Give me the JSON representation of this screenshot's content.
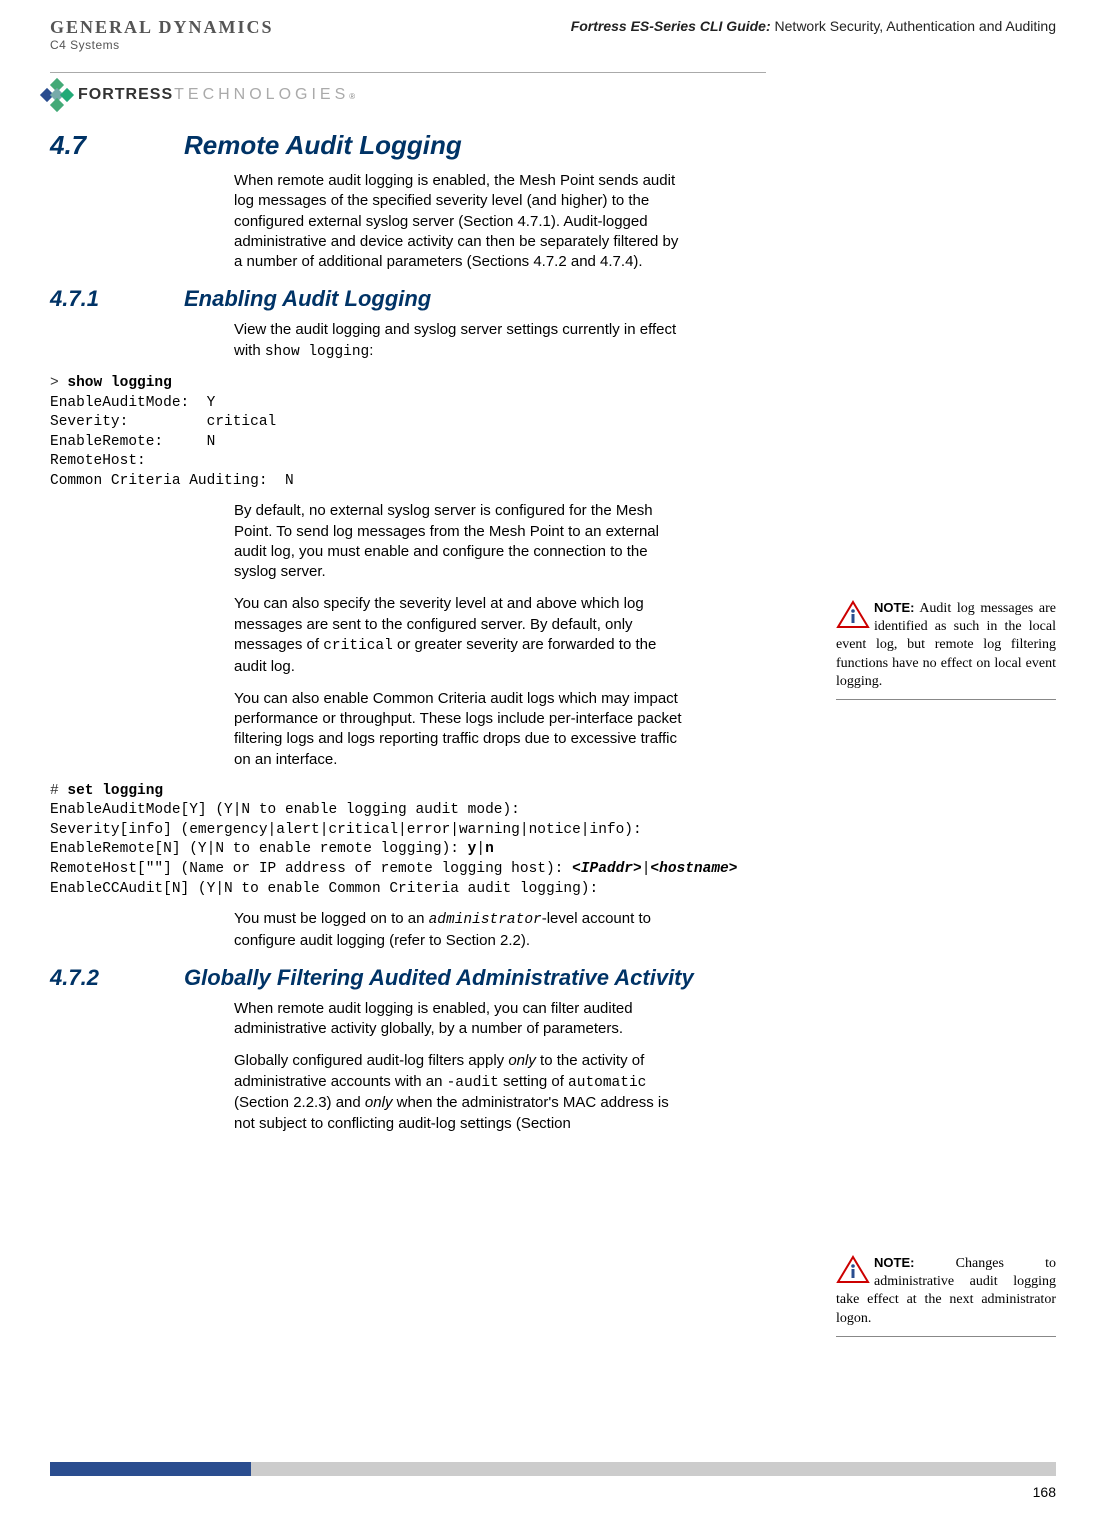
{
  "header": {
    "gd_main": "GENERAL DYNAMICS",
    "gd_sub": "C4 Systems",
    "title_bold": "Fortress ES-Series CLI Guide:",
    "title_rest": " Network Security, Authentication and Auditing",
    "fortress_bold": "FORTRESS",
    "fortress_light": "TECHNOLOGIES",
    "reg": "®"
  },
  "sections": {
    "s47": {
      "num": "4.7",
      "title": "Remote Audit Logging"
    },
    "s471": {
      "num": "4.7.1",
      "title": "Enabling Audit Logging"
    },
    "s472": {
      "num": "4.7.2",
      "title": "Globally Filtering Audited Administrative Activity"
    }
  },
  "paragraphs": {
    "p1": "When remote audit logging is enabled, the Mesh Point sends audit log messages of the specified severity level (and higher) to the configured external syslog server (Section 4.7.1). Audit-logged administrative and device activity can then be separately filtered by a number of additional parameters (Sections 4.7.2 and 4.7.4).",
    "p2a": "View the audit logging and syslog server settings currently in effect with ",
    "p2b": "show logging",
    "p2c": ":",
    "p3": "By default, no external syslog server is configured for the Mesh Point. To send log messages from the Mesh Point to an external audit log, you must enable and configure the connection to the syslog server.",
    "p4a": "You can also specify the severity level at and above which log messages are sent to the configured server. By default, only messages of ",
    "p4b": "critical",
    "p4c": " or greater severity are forwarded to the audit log.",
    "p5": "You can also enable Common Criteria audit logs which may impact performance or throughput. These logs include per-interface packet filtering logs and logs reporting traffic drops due to excessive traffic on an interface.",
    "p6a": "You must be logged on to an ",
    "p6b": "administrator",
    "p6c": "-level account to configure audit logging (refer to Section 2.2).",
    "p7": "When remote audit logging is enabled, you can filter audited administrative activity globally, by a number of parameters.",
    "p8a": "Globally configured audit-log filters apply ",
    "p8b": "only",
    "p8c": " to the activity of administrative accounts with an ",
    "p8d": "-audit",
    "p8e": " setting of ",
    "p8f": "automatic",
    "p8g": " (Section 2.2.3) and ",
    "p8h": "only",
    "p8i": " when the administrator's MAC address is not subject to conflicting audit-log settings (Section"
  },
  "code": {
    "c1_prompt": "> ",
    "c1_cmd": "show logging",
    "c1_l1": "EnableAuditMode:  Y",
    "c1_l2": "Severity:         critical",
    "c1_l3": "EnableRemote:     N",
    "c1_l4": "RemoteHost:",
    "c1_l5": "Common Criteria Auditing:  N",
    "c2_prompt": "# ",
    "c2_cmd": "set logging",
    "c2_l1": "EnableAuditMode[Y] (Y|N to enable logging audit mode):",
    "c2_l2": "Severity[info] (emergency|alert|critical|error|warning|notice|info):",
    "c2_l3a": "EnableRemote[N] (Y|N to enable remote logging): ",
    "c2_l3b": "y",
    "c2_l3c": "|",
    "c2_l3d": "n",
    "c2_l4a": "RemoteHost[\"\"] (Name or IP address of remote logging host): ",
    "c2_l4b": "<IPaddr>",
    "c2_l4c": "|",
    "c2_l4d": "<hostname>",
    "c2_l5": "EnableCCAudit[N] (Y|N to enable Common Criteria audit logging):"
  },
  "notes": {
    "n1_label": "NOTE:",
    "n1_text": " Audit log messages are identified as such in the local event log, but remote log filtering functions have no effect on local event logging.",
    "n2_label": "NOTE:",
    "n2_text": " Changes to administrative audit logging take effect at the next administrator logon."
  },
  "page_number": "168"
}
